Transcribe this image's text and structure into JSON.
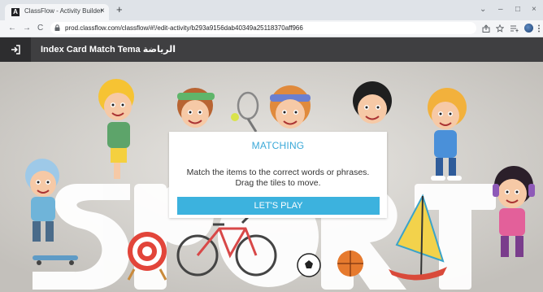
{
  "browser": {
    "tab_title": "ClassFlow - Activity Builder",
    "tab_close": "×",
    "new_tab": "+",
    "url": "prod.classflow.com/classflow/#!/edit-activity/b293a9156dab40349a25118370aff966",
    "back": "←",
    "forward": "→",
    "reload": "C",
    "minimize": "–",
    "maximize": "□",
    "close": "×",
    "chevron": "⌄"
  },
  "app": {
    "title": "Index Card Match Tema الرياضة"
  },
  "dialog": {
    "title": "MATCHING",
    "line1": "Match the items to the correct words or phrases.",
    "line2": "Drag the tiles to move.",
    "play_label": "LET'S PLAY"
  },
  "colors": {
    "header_bg": "#3f3f41",
    "accent": "#3cb2de",
    "title_accent": "#3ba9d8",
    "stage_bg": "#c8c6c2"
  },
  "icons": [
    "exit-icon",
    "lock-icon",
    "share-icon",
    "star-icon",
    "reading-list-icon",
    "profile-avatar",
    "menu-icon"
  ]
}
